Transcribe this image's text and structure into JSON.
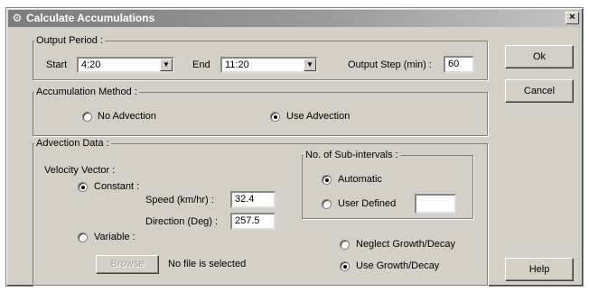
{
  "window": {
    "title": "Calculate Accumulations",
    "close_label": "×"
  },
  "output_period": {
    "legend": "Output Period :",
    "start_label": "Start",
    "start_value": "4:20",
    "end_label": "End",
    "end_value": "11:20",
    "step_label": "Output Step (min) :",
    "step_value": "60"
  },
  "accumulation_method": {
    "legend": "Accumulation Method :",
    "no_advection": "No Advection",
    "use_advection": "Use Advection",
    "selected": "use_advection"
  },
  "advection_data": {
    "legend": "Advection Data :",
    "velocity_label": "Velocity Vector :",
    "constant_label": "Constant :",
    "variable_label": "Variable :",
    "velocity_selected": "constant",
    "speed_label": "Speed  (km/hr) :",
    "speed_value": "32.4",
    "direction_label": "Direction (Deg) :",
    "direction_value": "257.5",
    "browse_label": "Browse",
    "file_status": "No file is selected",
    "subintervals": {
      "legend": "No. of Sub-intervals :",
      "automatic_label": "Automatic",
      "user_defined_label": "User Defined",
      "selected": "automatic",
      "user_defined_value": ""
    },
    "neglect_growth_label": "Neglect Growth/Decay",
    "use_growth_label": "Use Growth/Decay",
    "growth_selected": "use_growth"
  },
  "buttons": {
    "ok": "Ok",
    "cancel": "Cancel",
    "help": "Help"
  }
}
